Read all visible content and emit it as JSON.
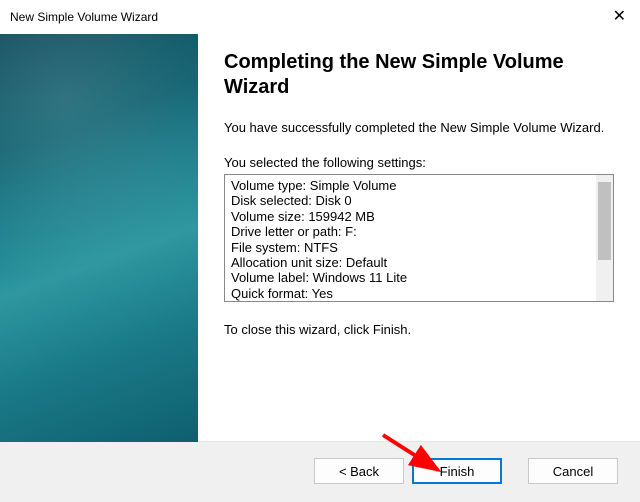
{
  "window": {
    "title": "New Simple Volume Wizard"
  },
  "content": {
    "heading": "Completing the New Simple Volume Wizard",
    "success_msg": "You have successfully completed the New Simple Volume Wizard.",
    "settings_label": "You selected the following settings:",
    "settings_lines": [
      "Volume type: Simple Volume",
      "Disk selected: Disk 0",
      "Volume size: 159942 MB",
      "Drive letter or path: F:",
      "File system: NTFS",
      "Allocation unit size: Default",
      "Volume label: Windows 11 Lite",
      "Quick format: Yes"
    ],
    "closing_msg": "To close this wizard, click Finish."
  },
  "buttons": {
    "back": "< Back",
    "finish": "Finish",
    "cancel": "Cancel"
  }
}
